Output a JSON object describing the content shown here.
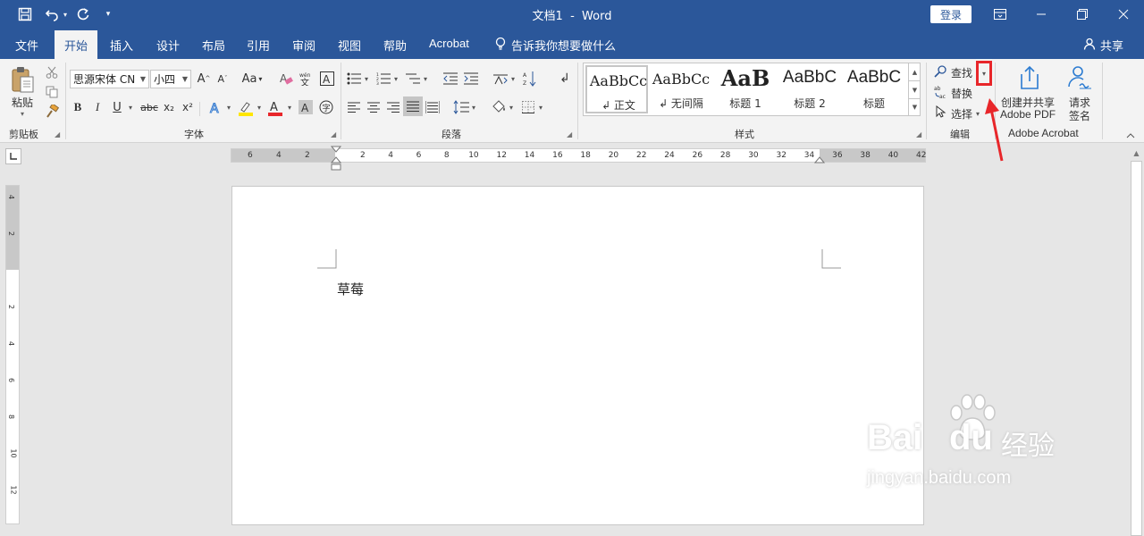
{
  "titlebar": {
    "title": "文档1  -  Word",
    "login": "登录"
  },
  "tabs": [
    "文件",
    "开始",
    "插入",
    "设计",
    "布局",
    "引用",
    "审阅",
    "视图",
    "帮助",
    "Acrobat"
  ],
  "tell_me": "告诉我你想要做什么",
  "share": "共享",
  "clipboard": {
    "paste": "粘贴",
    "group": "剪贴板"
  },
  "font": {
    "name": "思源宋体 CN",
    "size": "小四",
    "group": "字体",
    "wen": "变",
    "bold": "B",
    "italic": "I",
    "underline": "U",
    "strike": "abc",
    "sub": "x₂",
    "sup": "x²",
    "color_letter": "A",
    "aa": "Aa"
  },
  "paragraph": {
    "group": "段落"
  },
  "styles": {
    "group": "样式",
    "items": [
      {
        "preview": "AaBbCc",
        "name": "↲ 正文"
      },
      {
        "preview": "AaBbCc",
        "name": "↲ 无间隔"
      },
      {
        "preview": "AaB",
        "name": "标题 1"
      },
      {
        "preview": "AaBbC",
        "name": "标题 2"
      },
      {
        "preview": "AaBbC",
        "name": "标题"
      }
    ]
  },
  "editing": {
    "find": "查找",
    "replace": "替换",
    "select": "选择",
    "group": "编辑"
  },
  "acrobat": {
    "create": "创建并共享",
    "create2": "Adobe PDF",
    "request": "请求",
    "request2": "签名",
    "group": "Adobe Acrobat"
  },
  "ruler": {
    "h_left": [
      "6",
      "4",
      "2"
    ],
    "h_right": [
      "2",
      "4",
      "6",
      "8",
      "10",
      "12",
      "14",
      "16",
      "18",
      "20",
      "22",
      "24",
      "26",
      "28",
      "30",
      "32",
      "34",
      "36",
      "38",
      "40",
      "42"
    ],
    "v": [
      "4",
      "2",
      "",
      "2",
      "4",
      "6",
      "8",
      "10",
      "12"
    ]
  },
  "document": {
    "text": "草莓"
  },
  "watermark": {
    "brand": "Bai",
    "brand2": "du",
    "cn": "经验",
    "url": "jingyan.baidu.com"
  },
  "colors": {
    "accent": "#2b579a",
    "highlight": "#e8262a"
  }
}
